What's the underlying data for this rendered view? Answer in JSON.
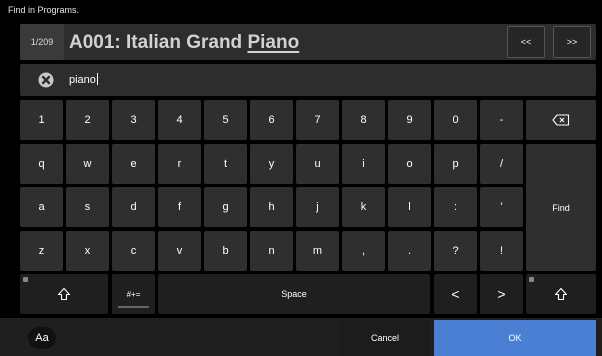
{
  "header": {
    "title": "Find  in Programs."
  },
  "program": {
    "counter": "1/209",
    "name_prefix": "A001: Italian Grand ",
    "name_match": "Piano",
    "prev_label": "<<",
    "next_label": ">>"
  },
  "search": {
    "value": "piano",
    "clear_icon": "clear-icon"
  },
  "keyboard": {
    "row1": [
      "1",
      "2",
      "3",
      "4",
      "5",
      "6",
      "7",
      "8",
      "9",
      "0",
      "-"
    ],
    "row2": [
      "q",
      "w",
      "e",
      "r",
      "t",
      "y",
      "u",
      "i",
      "o",
      "p",
      "/"
    ],
    "row3": [
      "a",
      "s",
      "d",
      "f",
      "g",
      "h",
      "j",
      "k",
      "l",
      ":",
      "'"
    ],
    "row4": [
      "z",
      "x",
      "c",
      "v",
      "b",
      "n",
      "m",
      ",",
      ".",
      "?",
      "!"
    ],
    "backspace_icon": "backspace-icon",
    "find_label": "Find",
    "shift_icon": "shift-up-icon",
    "symbols_label": "#+=",
    "space_label": "Space",
    "left_arrow": "<",
    "right_arrow": ">"
  },
  "footer": {
    "case_label": "Aa",
    "cancel_label": "Cancel",
    "ok_label": "OK"
  },
  "colors": {
    "ok_blue": "#4a7fd4",
    "key_gray": "#2f2f2f",
    "background": "#000000"
  }
}
